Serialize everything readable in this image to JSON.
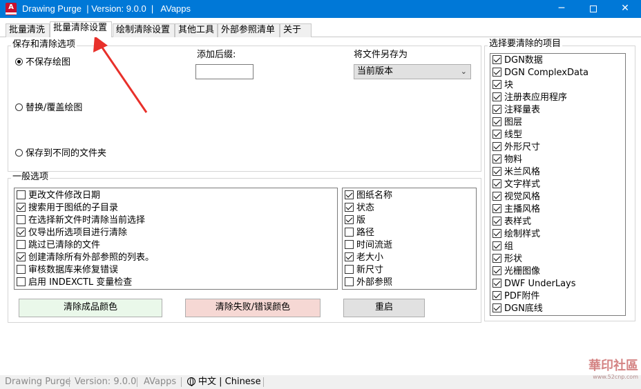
{
  "window": {
    "title": "Drawing Purge  | Version: 9.0.0  |   AVapps",
    "icon_letter": "A",
    "icon_name": "autocad-app-icon",
    "controls": {
      "minimize": "─",
      "close": "✕"
    }
  },
  "tabs": [
    "批量清洗",
    "批量清除设置",
    "绘制清除设置",
    "其他工具",
    "外部参照清单",
    "关于"
  ],
  "active_tab_index": 1,
  "save_options": {
    "group_title": "保存和清除选项",
    "radios": [
      {
        "label": "不保存绘图",
        "selected": true
      },
      {
        "label": "替换/覆盖绘图",
        "selected": false
      },
      {
        "label": "保存到不同的文件夹",
        "selected": false
      }
    ],
    "suffix_label": "添加后缀:",
    "suffix_value": "",
    "save_as_label": "将文件另存为",
    "save_as_value": "当前版本"
  },
  "general_options": {
    "group_title": "一般选项",
    "left_items": [
      {
        "label": "更改文件修改日期",
        "checked": false
      },
      {
        "label": "搜索用于图纸的子目录",
        "checked": true
      },
      {
        "label": "在选择新文件时清除当前选择",
        "checked": false
      },
      {
        "label": "仅导出所选项目进行清除",
        "checked": true
      },
      {
        "label": "跳过已清除的文件",
        "checked": false
      },
      {
        "label": "创建清除所有外部参照的列表。",
        "checked": true
      },
      {
        "label": "审核数据库来修复错误",
        "checked": false
      },
      {
        "label": "启用 INDEXCTL 变量检查",
        "checked": false
      }
    ],
    "right_items": [
      {
        "label": "图纸名称",
        "checked": true
      },
      {
        "label": "状态",
        "checked": true
      },
      {
        "label": "版",
        "checked": true
      },
      {
        "label": "路径",
        "checked": false
      },
      {
        "label": "时间流逝",
        "checked": false
      },
      {
        "label": "老大小",
        "checked": true
      },
      {
        "label": "新尺寸",
        "checked": false
      },
      {
        "label": "外部参照",
        "checked": false
      }
    ],
    "buttons": {
      "success_color": "清除成品颜色",
      "error_color": "清除失败/错误颜色",
      "restart": "重启"
    },
    "colors": {
      "success": "#eaf8ea",
      "error": "#f6d8d4",
      "restart": "#e1e1e1"
    }
  },
  "purge_items": {
    "group_title": "选择要清除的项目",
    "items": [
      {
        "label": "DGN数据",
        "checked": true
      },
      {
        "label": "DGN ComplexData",
        "checked": true
      },
      {
        "label": "块",
        "checked": true
      },
      {
        "label": "注册表应用程序",
        "checked": true
      },
      {
        "label": "注释量表",
        "checked": true
      },
      {
        "label": "图层",
        "checked": true
      },
      {
        "label": "线型",
        "checked": true
      },
      {
        "label": "外形尺寸",
        "checked": true
      },
      {
        "label": "物料",
        "checked": true
      },
      {
        "label": "米兰风格",
        "checked": true
      },
      {
        "label": "文字样式",
        "checked": true
      },
      {
        "label": "视觉风格",
        "checked": true
      },
      {
        "label": "主播风格",
        "checked": true
      },
      {
        "label": "表样式",
        "checked": true
      },
      {
        "label": "绘制样式",
        "checked": true
      },
      {
        "label": "组",
        "checked": true
      },
      {
        "label": "形状",
        "checked": true
      },
      {
        "label": "光栅图像",
        "checked": true
      },
      {
        "label": "DWF UnderLays",
        "checked": true
      },
      {
        "label": "PDF附件",
        "checked": true
      },
      {
        "label": "DGN底线",
        "checked": true
      }
    ]
  },
  "statusbar": {
    "app": "Drawing Purge",
    "version": "Version: 9.0.0",
    "vendor": "AVapps",
    "language": "中文 | Chinese"
  },
  "watermark": {
    "text": "華印社區",
    "url": "www.52cnp.com"
  },
  "annotation": {
    "color": "#e8302a"
  }
}
